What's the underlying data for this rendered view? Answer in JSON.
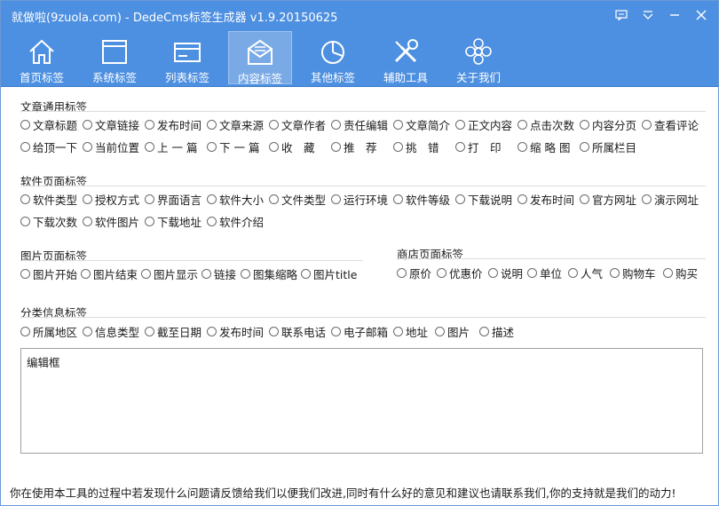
{
  "window": {
    "title": "就做啦(9zuola.com) - DedeCms标签生成器 v1.9.20150625",
    "title_bar_color": "#4d8fe0",
    "controls": [
      "feedback-icon",
      "menu-dropdown-icon",
      "minimize-icon",
      "close-icon"
    ]
  },
  "toolbar": {
    "active_index": 3,
    "items": [
      {
        "label": "首页标签",
        "icon": "home-icon"
      },
      {
        "label": "系统标签",
        "icon": "window-icon"
      },
      {
        "label": "列表标签",
        "icon": "card-icon"
      },
      {
        "label": "内容标签",
        "icon": "envelope-icon"
      },
      {
        "label": "其他标签",
        "icon": "pie-chart-icon"
      },
      {
        "label": "辅助工具",
        "icon": "tools-icon"
      },
      {
        "label": "关于我们",
        "icon": "flower-icon"
      }
    ]
  },
  "sections": {
    "article": {
      "title": "文章通用标签",
      "row1": [
        "文章标题",
        "文章链接",
        "发布时间",
        "文章来源",
        "文章作者",
        "责任编辑",
        "文章简介",
        "正文内容",
        "点击次数",
        "内容分页",
        "查看评论"
      ],
      "row2": [
        "给顶一下",
        "当前位置",
        "上 一 篇",
        "下 一 篇",
        "收　藏",
        "推　荐",
        "挑　错",
        "打　印",
        "缩 略 图",
        "所属栏目"
      ]
    },
    "software": {
      "title": "软件页面标签",
      "row1": [
        "软件类型",
        "授权方式",
        "界面语言",
        "软件大小",
        "文件类型",
        "运行环境",
        "软件等级",
        "下载说明",
        "发布时间",
        "官方网址",
        "演示网址"
      ],
      "row2": [
        "下载次数",
        "软件图片",
        "下载地址",
        "软件介绍"
      ]
    },
    "image": {
      "title": "图片页面标签",
      "row1": [
        "图片开始",
        "图片结束",
        "图片显示",
        "链接",
        "图集缩略",
        "图片title"
      ]
    },
    "shop": {
      "title": "商店页面标签",
      "row1": [
        "原价",
        "优惠价",
        "说明",
        "单位",
        "人气",
        "购物车",
        "购买"
      ]
    },
    "classified": {
      "title": "分类信息标签",
      "row1": [
        "所属地区",
        "信息类型",
        "截至日期",
        "发布时间",
        "联系电话",
        "电子邮箱",
        "地址",
        "图片",
        "描述"
      ]
    }
  },
  "editor": {
    "label": "编辑框",
    "value": ""
  },
  "footer": {
    "text": "你在使用本工具的过程中若发现什么问题请反馈给我们以便我们改进,同时有什么好的意见和建议也请联系我们,你的支持就是我们的动力!"
  }
}
